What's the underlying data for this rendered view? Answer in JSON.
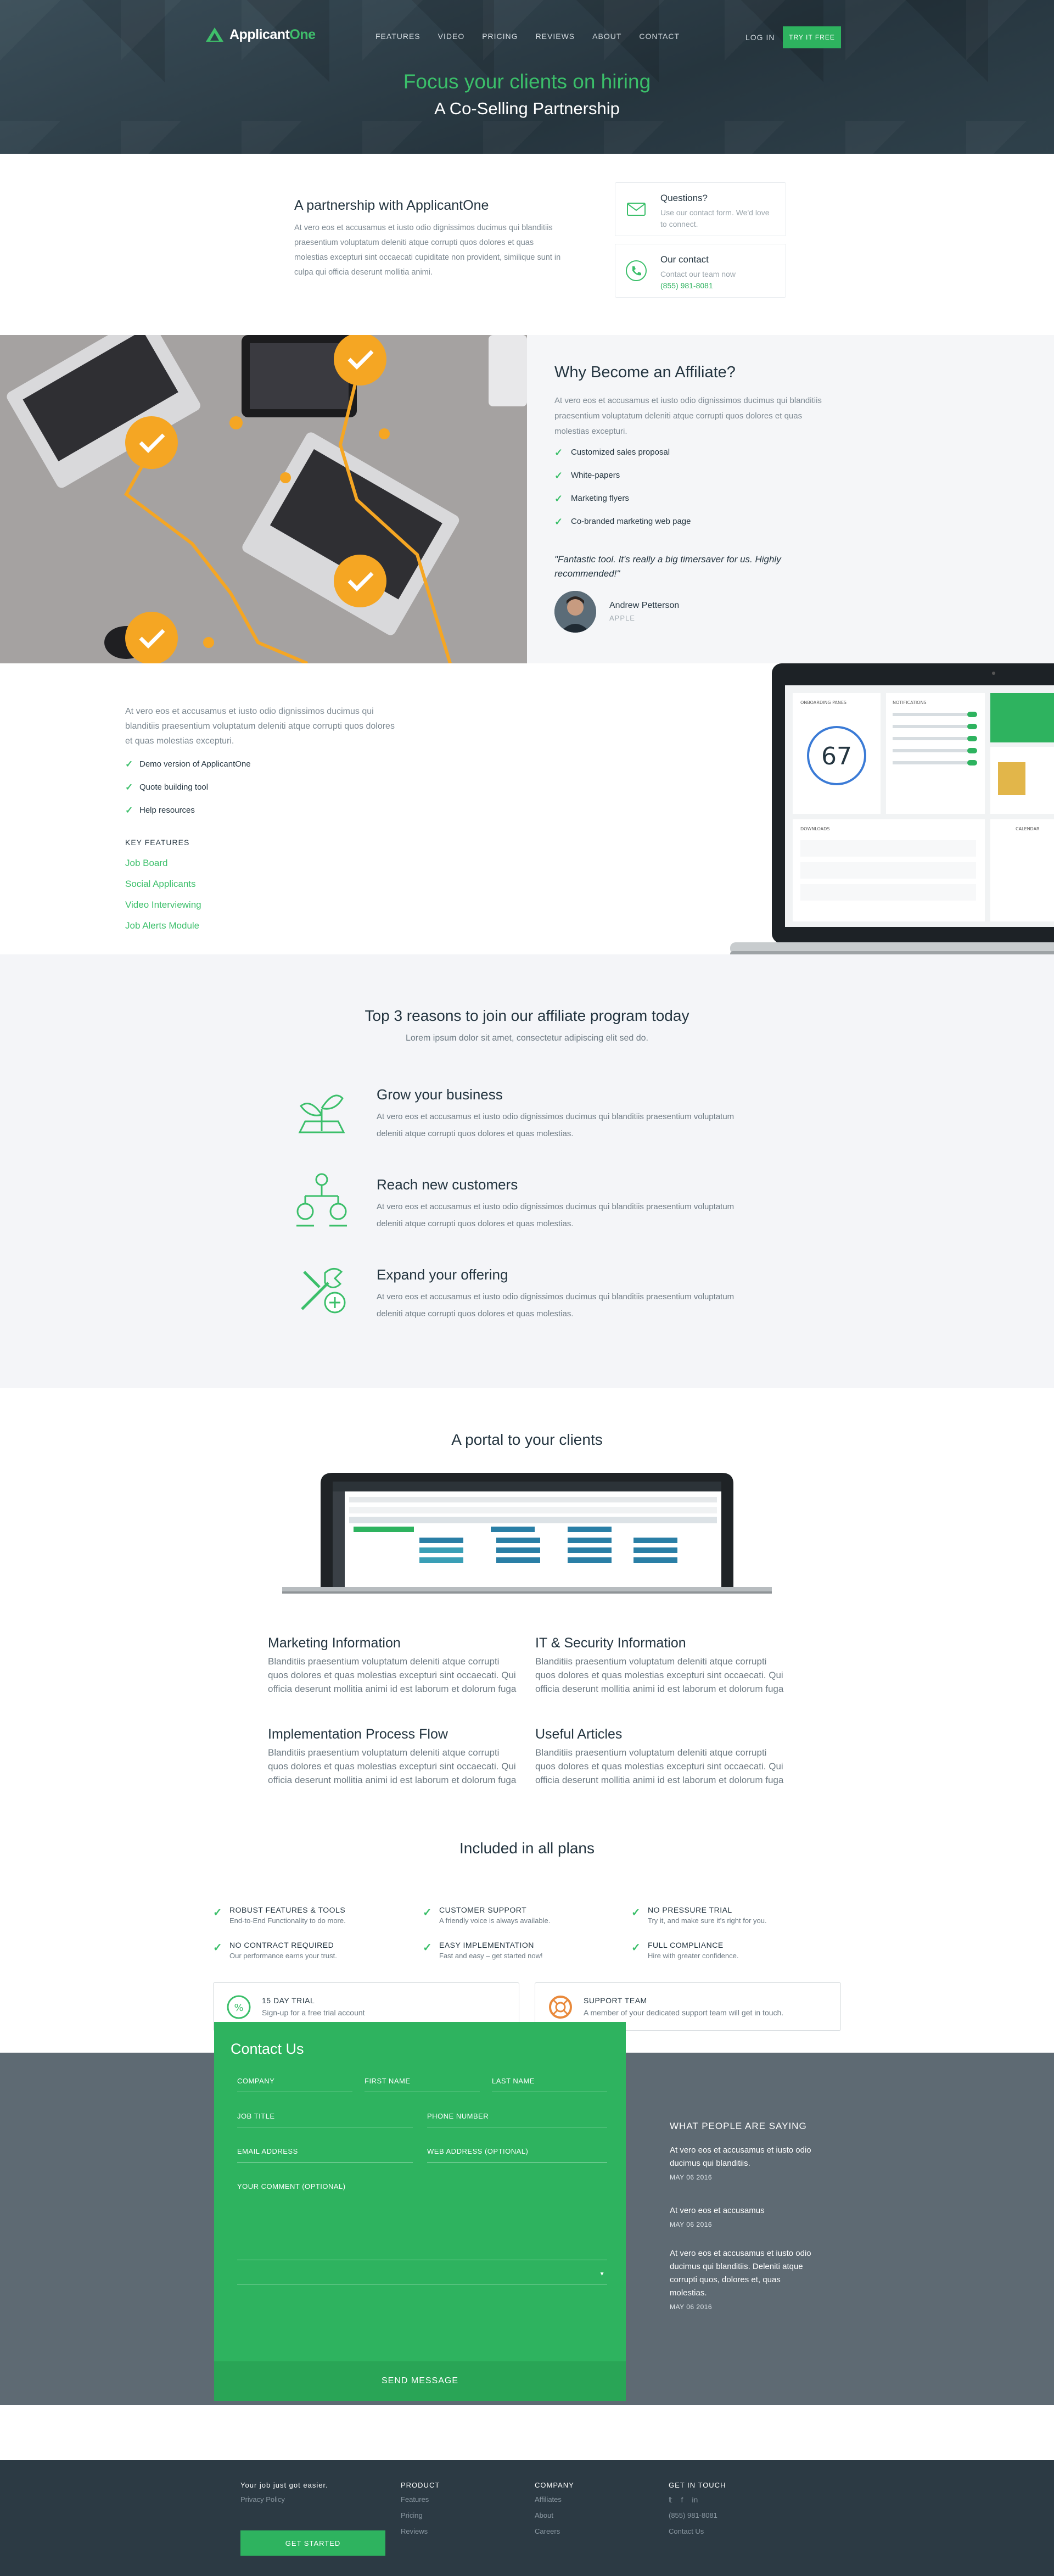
{
  "nav": {
    "logo": "ApplicantOne",
    "logo_main": "Applicant",
    "logo_accent": "One",
    "links": [
      "FEATURES",
      "VIDEO",
      "PRICING",
      "REVIEWS",
      "ABOUT",
      "CONTACT"
    ],
    "login": "LOG IN",
    "cta": "TRY IT FREE"
  },
  "hero": {
    "title": "Focus your clients on hiring",
    "subtitle": "A Co-Selling Partnership"
  },
  "partnership": {
    "title": "A partnership with ApplicantOne",
    "text": "At vero eos et accusamus et iusto odio dignissimos ducimus qui blanditiis praesentium voluptatum deleniti atque corrupti quos dolores et quas molestias excepturi sint occaecati cupiditate non provident, similique sunt in culpa qui officia deserunt mollitia animi.",
    "questions_title": "Questions?",
    "questions_text": "Use our contact form. We'd love to connect.",
    "contact_title": "Our contact",
    "contact_text": "Contact our team now",
    "contact_phone": "(855) 981-8081"
  },
  "affiliate": {
    "title": "Why Become an Affiliate?",
    "text": "At vero eos et accusamus et iusto odio dignissimos ducimus qui blanditiis praesentium voluptatum deleniti atque corrupti quos dolores et quas molestias excepturi.",
    "list": [
      "Customized sales proposal",
      "White-papers",
      "Marketing flyers",
      "Co-branded marketing web page"
    ],
    "quote": "\"Fantastic tool. It's really a big timersaver for us. Highly recommended!\"",
    "person": "Andrew Petterson",
    "company": "APPLE"
  },
  "demo": {
    "text": "At vero eos et accusamus et iusto odio dignissimos ducimus qui blanditiis praesentium voluptatum deleniti atque corrupti quos dolores et quas molestias excepturi.",
    "list": [
      "Demo version of ApplicantOne",
      "Quote building tool",
      "Help resources"
    ],
    "key_title": "KEY FEATURES",
    "key_links": [
      "Job Board",
      "Social Applicants",
      "Video Interviewing",
      "Job Alerts Module"
    ],
    "dash_score": "67",
    "dash_panels": [
      "ONBOARDING PANES",
      "NOTIFICATIONS",
      "DOWNLOADS",
      "CALENDAR"
    ]
  },
  "top3": {
    "title": "Top 3 reasons to join our affiliate program today",
    "subtitle": "Lorem ipsum dolor sit amet, consectetur adipiscing elit sed do.",
    "reasons": [
      {
        "title": "Grow your business",
        "text": "At vero eos et accusamus et iusto odio dignissimos ducimus qui blanditiis praesentium voluptatum deleniti atque corrupti quos dolores et quas molestias."
      },
      {
        "title": "Reach new customers",
        "text": "At vero eos et accusamus et iusto odio dignissimos ducimus qui blanditiis praesentium voluptatum deleniti atque corrupti quos dolores et quas molestias."
      },
      {
        "title": "Expand your offering",
        "text": "At vero eos et accusamus et iusto odio dignissimos ducimus qui blanditiis praesentium voluptatum deleniti atque corrupti quos dolores et quas molestias."
      }
    ]
  },
  "portal": {
    "title": "A portal to your clients",
    "features": [
      {
        "title": "Marketing Information",
        "text": "Blanditiis praesentium voluptatum deleniti atque corrupti quos dolores et quas molestias excepturi sint occaecati. Qui officia deserunt mollitia animi id est laborum et dolorum fuga"
      },
      {
        "title": "IT & Security Information",
        "text": "Blanditiis praesentium voluptatum deleniti atque corrupti quos dolores et quas molestias excepturi sint occaecati. Qui officia deserunt mollitia animi id est laborum et dolorum fuga"
      },
      {
        "title": "Implementation Process Flow",
        "text": "Blanditiis praesentium voluptatum deleniti atque corrupti quos dolores et quas molestias excepturi sint occaecati. Qui officia deserunt mollitia animi id est laborum et dolorum fuga"
      },
      {
        "title": "Useful Articles",
        "text": "Blanditiis praesentium voluptatum deleniti atque corrupti quos dolores et quas molestias excepturi sint occaecati. Qui officia deserunt mollitia animi id est laborum et dolorum fuga"
      }
    ]
  },
  "plans": {
    "title": "Included in all plans",
    "items": [
      {
        "title": "ROBUST FEATURES & TOOLS",
        "text": "End-to-End Functionality to do more."
      },
      {
        "title": "CUSTOMER SUPPORT",
        "text": "A friendly voice is always available."
      },
      {
        "title": "NO PRESSURE TRIAL",
        "text": "Try it, and make sure it's right for you."
      },
      {
        "title": "NO CONTRACT REQUIRED",
        "text": "Our performance earns your trust."
      },
      {
        "title": "EASY IMPLEMENTATION",
        "text": "Fast and easy – get started now!"
      },
      {
        "title": "FULL COMPLIANCE",
        "text": "Hire with greater confidence."
      }
    ],
    "trial_title": "15 DAY TRIAL",
    "trial_text": "Sign-up for a free trial account",
    "support_title": "SUPPORT TEAM",
    "support_text": "A member of your dedicated support team will get in touch."
  },
  "contact": {
    "title": "Contact Us",
    "fields": {
      "company": "COMPANY",
      "first_name": "FIRST NAME",
      "last_name": "LAST NAME",
      "job_title": "JOB TITLE",
      "phone": "PHONE NUMBER",
      "email": "EMAIL ADDRESS",
      "web": "WEB ADDRESS (OPTIONAL)",
      "comment": "YOUR COMMENT (OPTIONAL)"
    },
    "send": "SEND MESSAGE",
    "testimonials_title": "WHAT PEOPLE ARE SAYING",
    "testimonials": [
      {
        "text": "At vero eos et accusamus et iusto odio ducimus qui blanditiis.",
        "date": "MAY 06 2016"
      },
      {
        "text": "At vero eos et accusamus",
        "date": "MAY 06 2016"
      },
      {
        "text": "At vero eos et accusamus et iusto odio ducimus qui blanditiis. Deleniti atque corrupti quos, dolores et, quas molestias.",
        "date": "MAY 06 2016"
      }
    ]
  },
  "footer": {
    "tagline": "Your job just got easier.",
    "privacy": "Privacy Policy",
    "start": "GET STARTED",
    "product_title": "PRODUCT",
    "product_links": [
      "Features",
      "Pricing",
      "Reviews"
    ],
    "company_title": "COMPANY",
    "company_links": [
      "Affiliates",
      "About",
      "Careers"
    ],
    "touch_title": "GET IN TOUCH",
    "social": [
      "twitter-icon",
      "facebook-icon",
      "linkedin-icon"
    ],
    "phone": "(855) 981-8081",
    "contact": "Contact Us"
  },
  "colors": {
    "accent": "#2eb35f",
    "dark": "#2c3e48",
    "gray": "#5e6a73",
    "orange": "#f5a623"
  }
}
